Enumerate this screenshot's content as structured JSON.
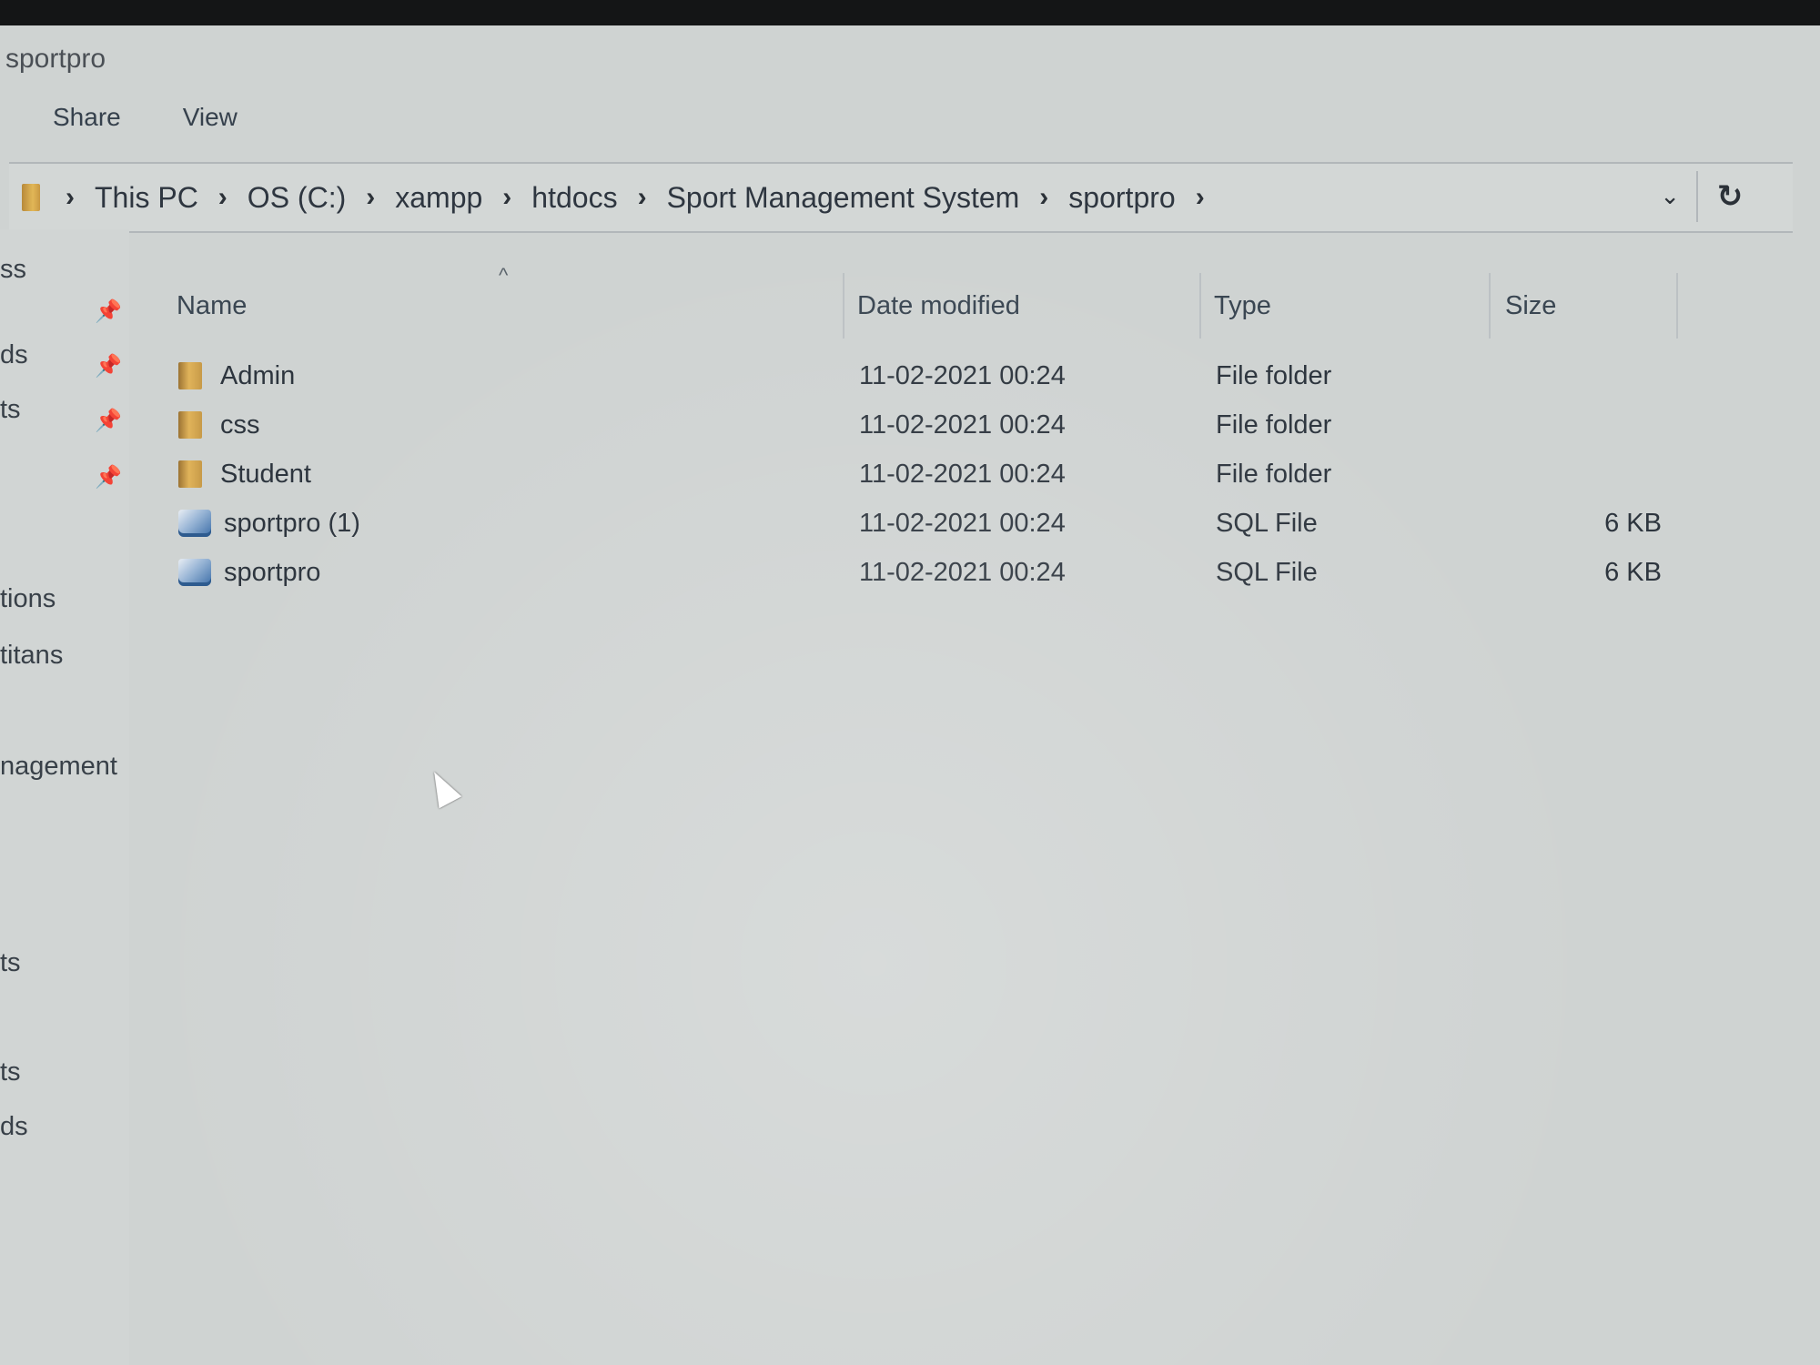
{
  "window": {
    "title": "sportpro"
  },
  "ribbon": {
    "tabs": [
      "Share",
      "View"
    ]
  },
  "address_bar": {
    "icon": "folder-icon",
    "crumbs": [
      "This PC",
      "OS (C:)",
      "xampp",
      "htdocs",
      "Sport Management System",
      "sportpro"
    ],
    "dropdown_icon": "chevron-down-icon",
    "refresh_icon": "refresh-icon"
  },
  "nav_pane": {
    "items": [
      "ss",
      "ds",
      "ts",
      "",
      "tions",
      "titans",
      "nagement",
      "ts",
      "ts",
      "ds"
    ],
    "pinned_count": 4
  },
  "file_list": {
    "columns": [
      "Name",
      "Date modified",
      "Type",
      "Size"
    ],
    "sort_indicator": "^",
    "rows": [
      {
        "name": "Admin",
        "date": "11-02-2021 00:24",
        "type": "File folder",
        "size": "",
        "icon": "folder-icon"
      },
      {
        "name": "css",
        "date": "11-02-2021 00:24",
        "type": "File folder",
        "size": "",
        "icon": "folder-icon"
      },
      {
        "name": "Student",
        "date": "11-02-2021 00:24",
        "type": "File folder",
        "size": "",
        "icon": "folder-icon"
      },
      {
        "name": "sportpro (1)",
        "date": "11-02-2021 00:24",
        "type": "SQL File",
        "size": "6 KB",
        "icon": "sql-file-icon"
      },
      {
        "name": "sportpro",
        "date": "11-02-2021 00:24",
        "type": "SQL File",
        "size": "6 KB",
        "icon": "sql-file-icon"
      }
    ]
  }
}
